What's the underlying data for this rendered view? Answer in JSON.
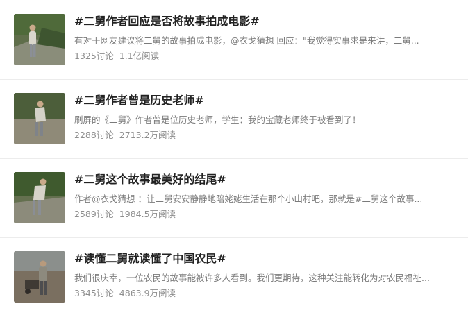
{
  "topics": [
    {
      "title": "#二舅作者回应是否将故事拍成电影#",
      "description": "有对于网友建议将二舅的故事拍成电影，@衣戈猜想 回应：\"我觉得实事求是来讲，二舅...",
      "discussions": "1325讨论",
      "reads": "1.1亿阅读",
      "thumb_icon": "man-climbing-hill-photo"
    },
    {
      "title": "#二舅作者曾是历史老师#",
      "description": "刷屏的《二舅》作者曾是位历史老师，学生：我的宝藏老师终于被看到了！",
      "discussions": "2288讨论",
      "reads": "2713.2万阅读",
      "thumb_icon": "man-bending-near-wall-photo"
    },
    {
      "title": "#二舅这个故事最美好的结尾#",
      "description": "作者@衣戈猜想 ：让二舅安安静静地陪姥姥生活在那个小山村吧，那就是#二舅这个故事...",
      "discussions": "2589讨论",
      "reads": "1984.5万阅读",
      "thumb_icon": "man-walking-uphill-photo"
    },
    {
      "title": "#读懂二舅就读懂了中国农民#",
      "description": "我们很庆幸，一位农民的故事能被许多人看到。我们更期待，这种关注能转化为对农民福祉...",
      "discussions": "3345讨论",
      "reads": "4863.9万阅读",
      "thumb_icon": "man-with-wheelbarrow-photo"
    }
  ]
}
